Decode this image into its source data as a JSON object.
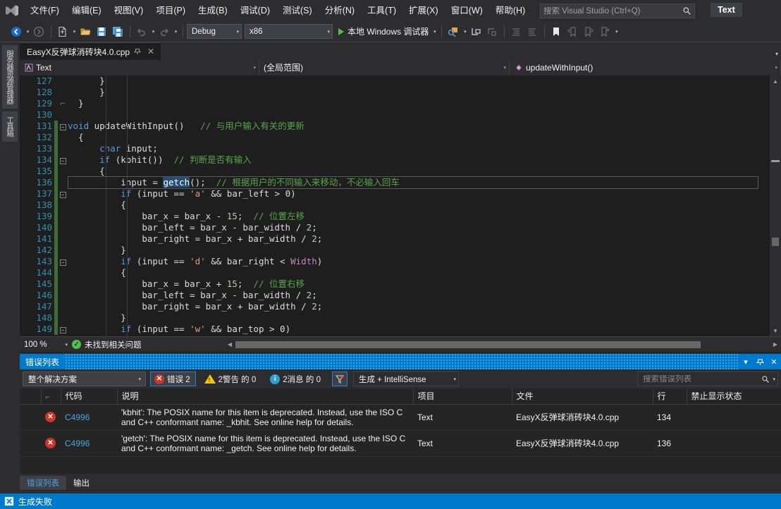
{
  "app": {
    "logo_icon": "visual-studio-logo",
    "text_badge": "Text"
  },
  "menubar": {
    "items": [
      {
        "label": "文件(F)"
      },
      {
        "label": "编辑(E)"
      },
      {
        "label": "视图(V)"
      },
      {
        "label": "项目(P)"
      },
      {
        "label": "生成(B)"
      },
      {
        "label": "调试(D)"
      },
      {
        "label": "测试(S)"
      },
      {
        "label": "分析(N)"
      },
      {
        "label": "工具(T)"
      },
      {
        "label": "扩展(X)"
      },
      {
        "label": "窗口(W)"
      },
      {
        "label": "帮助(H)"
      }
    ],
    "search_placeholder": "搜索 Visual Studio (Ctrl+Q)",
    "search_value": "",
    "search_icon": "search-icon"
  },
  "toolbar": {
    "config_label": "Debug",
    "platform_label": "x86",
    "run_label": "本地 Windows 调试器",
    "icons": [
      "back-navigate-icon",
      "forward-navigate-icon",
      "new-item-icon",
      "open-file-icon",
      "save-icon",
      "save-all-icon",
      "undo-icon",
      "redo-icon",
      "start-without-debug-icon",
      "step-into-icon",
      "step-over-icon",
      "indent-icon",
      "outdent-icon",
      "bookmark-icon",
      "prev-bookmark-icon",
      "next-bookmark-icon",
      "clear-bookmarks-icon",
      "overflow-chevron-icon"
    ]
  },
  "leftdock": {
    "tabs": [
      {
        "label": "服务器资源管理器"
      },
      {
        "label": "工具箱"
      }
    ]
  },
  "editor": {
    "tab": {
      "title": "EasyX反弹球消砖块4.0.cpp",
      "pin_icon": "pin-icon",
      "close_icon": "close-icon"
    },
    "navbar": {
      "type_label": "Text",
      "type_icon": "class-member-icon",
      "scope_label": "(全局范围)",
      "member_label": "updateWithInput()",
      "member_icon": "method-icon"
    },
    "statusbar": {
      "zoom": "100 %",
      "issue_status": "未找到相关问题",
      "ok_icon": "check-circle-icon"
    },
    "lines": [
      {
        "n": "127",
        "fold": "",
        "change": "none",
        "tokens": [
          {
            "t": "      ",
            "c": "pln"
          },
          {
            "t": "}",
            "c": "pln"
          }
        ]
      },
      {
        "n": "128",
        "fold": "",
        "change": "none",
        "tokens": [
          {
            "t": "      }",
            "c": "pln"
          }
        ]
      },
      {
        "n": "129",
        "fold": "end",
        "change": "none",
        "tokens": [
          {
            "t": "  }",
            "c": "pln"
          }
        ]
      },
      {
        "n": "130",
        "fold": "",
        "change": "none",
        "tokens": []
      },
      {
        "n": "131",
        "fold": "minus",
        "change": "green",
        "tokens": [
          {
            "t": "void",
            "c": "kw"
          },
          {
            "t": " updateWithInput() ",
            "c": "pln"
          },
          {
            "t": "  // 与用户输入有关的更新",
            "c": "cmt"
          }
        ]
      },
      {
        "n": "132",
        "fold": "",
        "change": "green",
        "tokens": [
          {
            "t": "  {",
            "c": "pln"
          }
        ]
      },
      {
        "n": "133",
        "fold": "",
        "change": "green",
        "tokens": [
          {
            "t": "      ",
            "c": "pln"
          },
          {
            "t": "char",
            "c": "kw"
          },
          {
            "t": " input;",
            "c": "pln"
          }
        ]
      },
      {
        "n": "134",
        "fold": "minus",
        "change": "green",
        "tokens": [
          {
            "t": "      ",
            "c": "pln"
          },
          {
            "t": "if",
            "c": "kw"
          },
          {
            "t": " (kbhit())  ",
            "c": "pln"
          },
          {
            "t": "// 判断是否有输入",
            "c": "cmt"
          }
        ]
      },
      {
        "n": "135",
        "fold": "",
        "change": "green",
        "tokens": [
          {
            "t": "      {",
            "c": "pln"
          }
        ]
      },
      {
        "n": "136",
        "fold": "",
        "change": "green",
        "current": true,
        "tokens": [
          {
            "t": "          input = ",
            "c": "pln"
          },
          {
            "t": "getch",
            "c": "sel"
          },
          {
            "t": "();  ",
            "c": "pln"
          },
          {
            "t": "// 根据用户的不同输入来移动，不必输入回车",
            "c": "cmt"
          }
        ]
      },
      {
        "n": "137",
        "fold": "minus",
        "change": "green",
        "tokens": [
          {
            "t": "          ",
            "c": "pln"
          },
          {
            "t": "if",
            "c": "kw"
          },
          {
            "t": " (input == ",
            "c": "pln"
          },
          {
            "t": "'a'",
            "c": "str"
          },
          {
            "t": " && bar_left > 0)",
            "c": "pln"
          }
        ]
      },
      {
        "n": "138",
        "fold": "",
        "change": "green",
        "tokens": [
          {
            "t": "          {",
            "c": "pln"
          }
        ]
      },
      {
        "n": "139",
        "fold": "",
        "change": "green",
        "tokens": [
          {
            "t": "              bar_x = bar_x - ",
            "c": "pln"
          },
          {
            "t": "15",
            "c": "num"
          },
          {
            "t": ";  ",
            "c": "pln"
          },
          {
            "t": "// 位置左移",
            "c": "cmt"
          }
        ]
      },
      {
        "n": "140",
        "fold": "",
        "change": "green",
        "tokens": [
          {
            "t": "              bar_left = bar_x - bar_width / ",
            "c": "pln"
          },
          {
            "t": "2",
            "c": "num"
          },
          {
            "t": ";",
            "c": "pln"
          }
        ]
      },
      {
        "n": "141",
        "fold": "",
        "change": "green",
        "tokens": [
          {
            "t": "              bar_right = bar_x + bar_width / ",
            "c": "pln"
          },
          {
            "t": "2",
            "c": "num"
          },
          {
            "t": ";",
            "c": "pln"
          }
        ]
      },
      {
        "n": "142",
        "fold": "",
        "change": "green",
        "tokens": [
          {
            "t": "          }",
            "c": "pln"
          }
        ]
      },
      {
        "n": "143",
        "fold": "minus",
        "change": "green",
        "tokens": [
          {
            "t": "          ",
            "c": "pln"
          },
          {
            "t": "if",
            "c": "kw"
          },
          {
            "t": " (input == ",
            "c": "pln"
          },
          {
            "t": "'d'",
            "c": "str"
          },
          {
            "t": " && bar_right < ",
            "c": "pln"
          },
          {
            "t": "Width",
            "c": "mac"
          },
          {
            "t": ")",
            "c": "pln"
          }
        ]
      },
      {
        "n": "144",
        "fold": "",
        "change": "green",
        "tokens": [
          {
            "t": "          {",
            "c": "pln"
          }
        ]
      },
      {
        "n": "145",
        "fold": "",
        "change": "green",
        "tokens": [
          {
            "t": "              bar_x = bar_x + ",
            "c": "pln"
          },
          {
            "t": "15",
            "c": "num"
          },
          {
            "t": ";  ",
            "c": "pln"
          },
          {
            "t": "// 位置右移",
            "c": "cmt"
          }
        ]
      },
      {
        "n": "146",
        "fold": "",
        "change": "green",
        "tokens": [
          {
            "t": "              bar_left = bar_x - bar_width / ",
            "c": "pln"
          },
          {
            "t": "2",
            "c": "num"
          },
          {
            "t": ";",
            "c": "pln"
          }
        ]
      },
      {
        "n": "147",
        "fold": "",
        "change": "green",
        "tokens": [
          {
            "t": "              bar_right = bar_x + bar_width / ",
            "c": "pln"
          },
          {
            "t": "2",
            "c": "num"
          },
          {
            "t": ";",
            "c": "pln"
          }
        ]
      },
      {
        "n": "148",
        "fold": "",
        "change": "green",
        "tokens": [
          {
            "t": "          }",
            "c": "pln"
          }
        ]
      },
      {
        "n": "149",
        "fold": "minus",
        "change": "green",
        "tokens": [
          {
            "t": "          ",
            "c": "pln"
          },
          {
            "t": "if",
            "c": "kw"
          },
          {
            "t": " (input == ",
            "c": "pln"
          },
          {
            "t": "'w'",
            "c": "str"
          },
          {
            "t": " && bar_top > 0)",
            "c": "pln"
          }
        ]
      }
    ]
  },
  "errorlist": {
    "title": "错误列表",
    "title_buttons": [
      "chevron-down-icon",
      "pin-icon",
      "close-icon"
    ],
    "scope_label": "整个解决方案",
    "errors_label": "错误 2",
    "warnings_label": "2警告 的 0",
    "messages_label": "2消息 的 0",
    "filter_icon": "filter-icon",
    "build_label": "生成 + IntelliSense",
    "search_placeholder": "搜索错误列表",
    "search_value": "",
    "columns": [
      {
        "label": ""
      },
      {
        "label": ""
      },
      {
        "label": "代码"
      },
      {
        "label": "说明"
      },
      {
        "label": "项目"
      },
      {
        "label": "文件"
      },
      {
        "label": "行"
      },
      {
        "label": "禁止显示状态"
      }
    ],
    "rows": [
      {
        "severity_icon": "error-icon",
        "code": "C4996",
        "description": "'kbhit': The POSIX name for this item is deprecated. Instead, use the ISO C and C++ conformant name: _kbhit. See online help for details.",
        "project": "Text",
        "file": "EasyX反弹球消砖块4.0.cpp",
        "line": "134",
        "suppression": ""
      },
      {
        "severity_icon": "error-icon",
        "code": "C4996",
        "description": "'getch': The POSIX name for this item is deprecated. Instead, use the ISO C and C++ conformant name: _getch. See online help for details.",
        "project": "Text",
        "file": "EasyX反弹球消砖块4.0.cpp",
        "line": "136",
        "suppression": ""
      }
    ]
  },
  "bottomtabs": {
    "items": [
      {
        "label": "错误列表",
        "active": true
      },
      {
        "label": "输出",
        "active": false
      }
    ]
  },
  "statusbar": {
    "message": "生成失败",
    "icon": "build-failed-icon"
  },
  "colors": {
    "accent": "#007acc",
    "error": "#c9372c",
    "warning": "#f2c811",
    "info": "#2d9cdb",
    "chrome": "#2d2d30",
    "editor_bg": "#1e1e1e"
  }
}
